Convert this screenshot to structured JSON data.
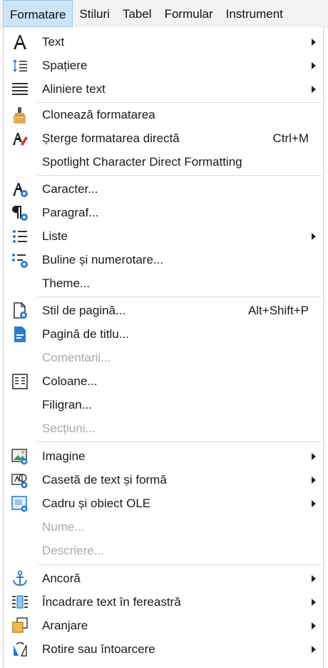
{
  "menubar": {
    "items": [
      {
        "label": "Formatare",
        "active": true
      },
      {
        "label": "Stiluri"
      },
      {
        "label": "Tabel"
      },
      {
        "label": "Formular"
      },
      {
        "label": "Instrument"
      }
    ]
  },
  "menu": {
    "items": [
      {
        "label": "Text",
        "icon": "text-A-icon",
        "submenu": true
      },
      {
        "label": "Spațiere",
        "icon": "line-spacing-icon",
        "submenu": true
      },
      {
        "label": "Aliniere text",
        "icon": "align-justify-icon",
        "submenu": true
      },
      {
        "label": "Clonează formatarea",
        "icon": "paintbrush-icon"
      },
      {
        "label": "Șterge formatarea directă",
        "icon": "clear-formatting-icon",
        "shortcut": "Ctrl+M"
      },
      {
        "label": "Spotlight Character Direct Formatting"
      },
      {
        "label": "Caracter...",
        "icon": "character-icon"
      },
      {
        "label": "Paragraf...",
        "icon": "paragraph-icon"
      },
      {
        "label": "Liste",
        "icon": "list-icon",
        "submenu": true
      },
      {
        "label": "Buline și numerotare...",
        "icon": "bullets-numbering-icon"
      },
      {
        "label": "Theme..."
      },
      {
        "label": "Stil de pagină...",
        "icon": "page-style-icon",
        "shortcut": "Alt+Shift+P"
      },
      {
        "label": "Pagină de titlu...",
        "icon": "title-page-icon"
      },
      {
        "label": "Comentarii...",
        "disabled": true
      },
      {
        "label": "Coloane...",
        "icon": "columns-icon"
      },
      {
        "label": "Filigran..."
      },
      {
        "label": "Secțiuni...",
        "disabled": true
      },
      {
        "label": "Imagine",
        "icon": "image-icon",
        "submenu": true
      },
      {
        "label": "Casetă de text și formă",
        "icon": "textbox-shape-icon",
        "submenu": true
      },
      {
        "label": "Cadru și obiect OLE",
        "icon": "frame-object-icon",
        "submenu": true
      },
      {
        "label": "Nume...",
        "disabled": true
      },
      {
        "label": "Descriere...",
        "disabled": true
      },
      {
        "label": "Ancoră",
        "icon": "anchor-icon",
        "submenu": true
      },
      {
        "label": "Încadrare text în fereastră",
        "icon": "text-wrap-icon",
        "submenu": true
      },
      {
        "label": "Aranjare",
        "icon": "arrange-icon",
        "submenu": true
      },
      {
        "label": "Rotire sau întoarcere",
        "icon": "rotate-flip-icon",
        "submenu": true
      }
    ]
  }
}
